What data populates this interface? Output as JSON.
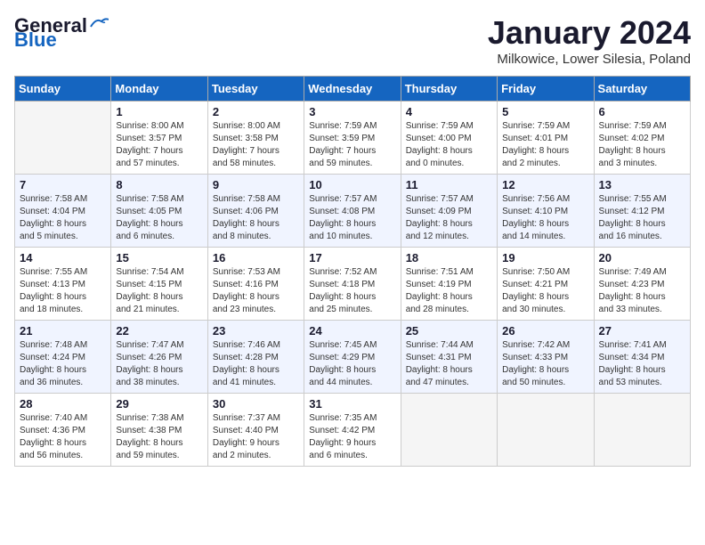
{
  "header": {
    "logo_line1": "General",
    "logo_line2": "Blue",
    "month_title": "January 2024",
    "subtitle": "Milkowice, Lower Silesia, Poland"
  },
  "weekdays": [
    "Sunday",
    "Monday",
    "Tuesday",
    "Wednesday",
    "Thursday",
    "Friday",
    "Saturday"
  ],
  "weeks": [
    [
      {
        "day": "",
        "info": ""
      },
      {
        "day": "1",
        "info": "Sunrise: 8:00 AM\nSunset: 3:57 PM\nDaylight: 7 hours\nand 57 minutes."
      },
      {
        "day": "2",
        "info": "Sunrise: 8:00 AM\nSunset: 3:58 PM\nDaylight: 7 hours\nand 58 minutes."
      },
      {
        "day": "3",
        "info": "Sunrise: 7:59 AM\nSunset: 3:59 PM\nDaylight: 7 hours\nand 59 minutes."
      },
      {
        "day": "4",
        "info": "Sunrise: 7:59 AM\nSunset: 4:00 PM\nDaylight: 8 hours\nand 0 minutes."
      },
      {
        "day": "5",
        "info": "Sunrise: 7:59 AM\nSunset: 4:01 PM\nDaylight: 8 hours\nand 2 minutes."
      },
      {
        "day": "6",
        "info": "Sunrise: 7:59 AM\nSunset: 4:02 PM\nDaylight: 8 hours\nand 3 minutes."
      }
    ],
    [
      {
        "day": "7",
        "info": "Sunrise: 7:58 AM\nSunset: 4:04 PM\nDaylight: 8 hours\nand 5 minutes."
      },
      {
        "day": "8",
        "info": "Sunrise: 7:58 AM\nSunset: 4:05 PM\nDaylight: 8 hours\nand 6 minutes."
      },
      {
        "day": "9",
        "info": "Sunrise: 7:58 AM\nSunset: 4:06 PM\nDaylight: 8 hours\nand 8 minutes."
      },
      {
        "day": "10",
        "info": "Sunrise: 7:57 AM\nSunset: 4:08 PM\nDaylight: 8 hours\nand 10 minutes."
      },
      {
        "day": "11",
        "info": "Sunrise: 7:57 AM\nSunset: 4:09 PM\nDaylight: 8 hours\nand 12 minutes."
      },
      {
        "day": "12",
        "info": "Sunrise: 7:56 AM\nSunset: 4:10 PM\nDaylight: 8 hours\nand 14 minutes."
      },
      {
        "day": "13",
        "info": "Sunrise: 7:55 AM\nSunset: 4:12 PM\nDaylight: 8 hours\nand 16 minutes."
      }
    ],
    [
      {
        "day": "14",
        "info": "Sunrise: 7:55 AM\nSunset: 4:13 PM\nDaylight: 8 hours\nand 18 minutes."
      },
      {
        "day": "15",
        "info": "Sunrise: 7:54 AM\nSunset: 4:15 PM\nDaylight: 8 hours\nand 21 minutes."
      },
      {
        "day": "16",
        "info": "Sunrise: 7:53 AM\nSunset: 4:16 PM\nDaylight: 8 hours\nand 23 minutes."
      },
      {
        "day": "17",
        "info": "Sunrise: 7:52 AM\nSunset: 4:18 PM\nDaylight: 8 hours\nand 25 minutes."
      },
      {
        "day": "18",
        "info": "Sunrise: 7:51 AM\nSunset: 4:19 PM\nDaylight: 8 hours\nand 28 minutes."
      },
      {
        "day": "19",
        "info": "Sunrise: 7:50 AM\nSunset: 4:21 PM\nDaylight: 8 hours\nand 30 minutes."
      },
      {
        "day": "20",
        "info": "Sunrise: 7:49 AM\nSunset: 4:23 PM\nDaylight: 8 hours\nand 33 minutes."
      }
    ],
    [
      {
        "day": "21",
        "info": "Sunrise: 7:48 AM\nSunset: 4:24 PM\nDaylight: 8 hours\nand 36 minutes."
      },
      {
        "day": "22",
        "info": "Sunrise: 7:47 AM\nSunset: 4:26 PM\nDaylight: 8 hours\nand 38 minutes."
      },
      {
        "day": "23",
        "info": "Sunrise: 7:46 AM\nSunset: 4:28 PM\nDaylight: 8 hours\nand 41 minutes."
      },
      {
        "day": "24",
        "info": "Sunrise: 7:45 AM\nSunset: 4:29 PM\nDaylight: 8 hours\nand 44 minutes."
      },
      {
        "day": "25",
        "info": "Sunrise: 7:44 AM\nSunset: 4:31 PM\nDaylight: 8 hours\nand 47 minutes."
      },
      {
        "day": "26",
        "info": "Sunrise: 7:42 AM\nSunset: 4:33 PM\nDaylight: 8 hours\nand 50 minutes."
      },
      {
        "day": "27",
        "info": "Sunrise: 7:41 AM\nSunset: 4:34 PM\nDaylight: 8 hours\nand 53 minutes."
      }
    ],
    [
      {
        "day": "28",
        "info": "Sunrise: 7:40 AM\nSunset: 4:36 PM\nDaylight: 8 hours\nand 56 minutes."
      },
      {
        "day": "29",
        "info": "Sunrise: 7:38 AM\nSunset: 4:38 PM\nDaylight: 8 hours\nand 59 minutes."
      },
      {
        "day": "30",
        "info": "Sunrise: 7:37 AM\nSunset: 4:40 PM\nDaylight: 9 hours\nand 2 minutes."
      },
      {
        "day": "31",
        "info": "Sunrise: 7:35 AM\nSunset: 4:42 PM\nDaylight: 9 hours\nand 6 minutes."
      },
      {
        "day": "",
        "info": ""
      },
      {
        "day": "",
        "info": ""
      },
      {
        "day": "",
        "info": ""
      }
    ]
  ]
}
